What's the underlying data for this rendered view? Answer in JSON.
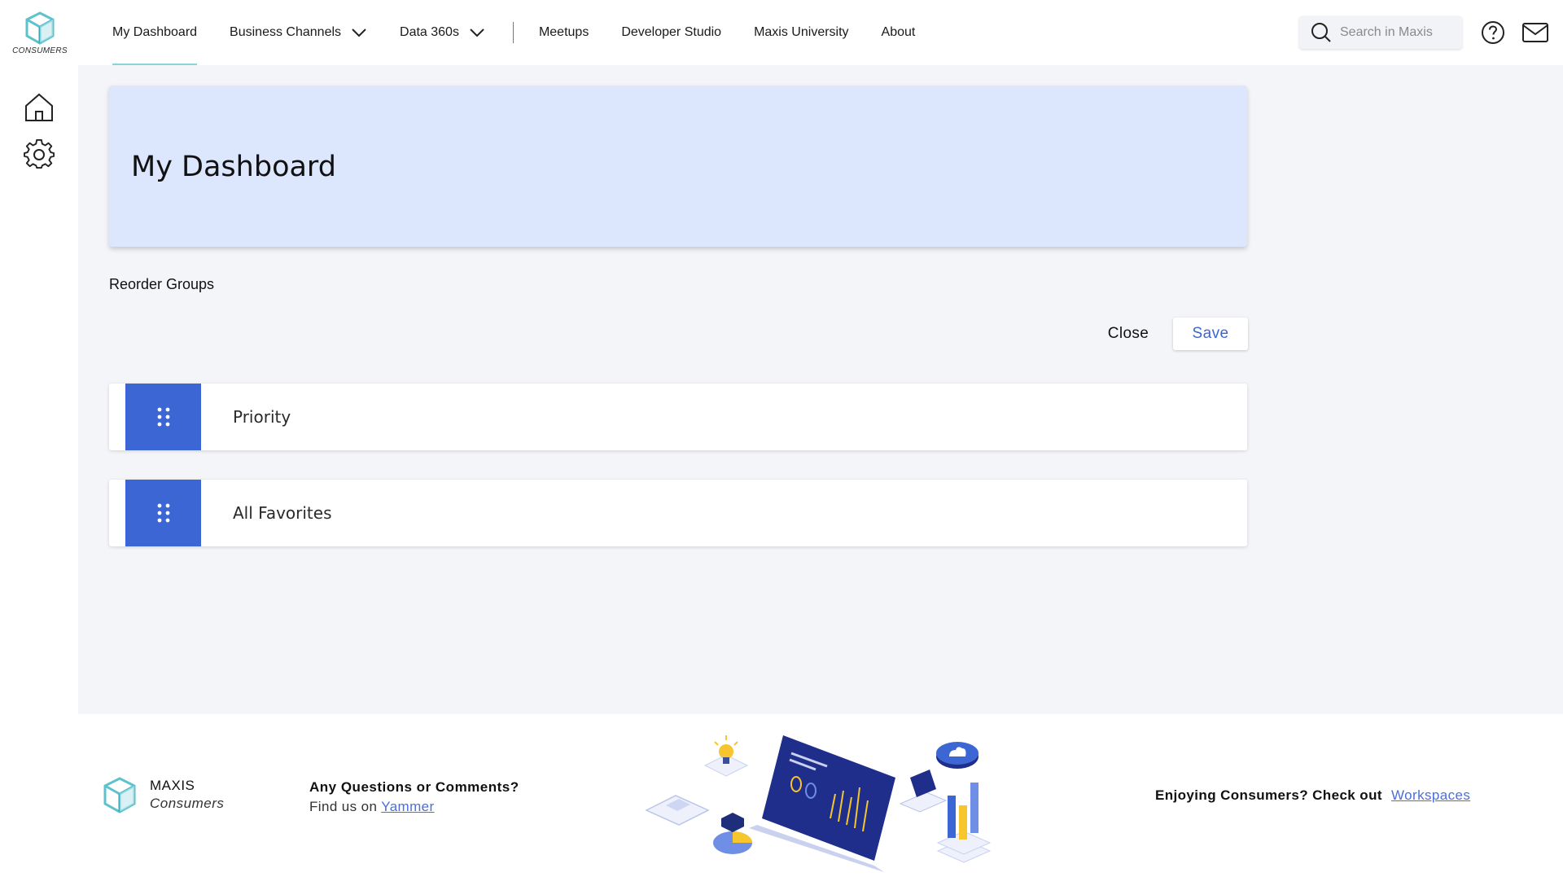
{
  "app": {
    "logo_text": "CONSUMERS"
  },
  "nav": {
    "items": [
      {
        "label": "My Dashboard",
        "active": true
      },
      {
        "label": "Business Channels",
        "dropdown": true
      },
      {
        "label": "Data 360s",
        "dropdown": true
      },
      {
        "label": "Meetups"
      },
      {
        "label": "Developer Studio"
      },
      {
        "label": "Maxis University"
      },
      {
        "label": "About"
      }
    ]
  },
  "search": {
    "placeholder": "Search in Maxis"
  },
  "icons": {
    "search": "search-icon",
    "help": "help-icon",
    "mail": "mail-icon",
    "home": "home-icon",
    "settings": "gear-icon",
    "drag": "drag-handle-icon"
  },
  "hero": {
    "title": "My Dashboard"
  },
  "reorder": {
    "title": "Reorder Groups",
    "close_label": "Close",
    "save_label": "Save",
    "groups": [
      {
        "label": "Priority"
      },
      {
        "label": "All Favorites"
      }
    ]
  },
  "footer": {
    "brand_line1": "MAXIS",
    "brand_line2": "Consumers",
    "questions": "Any Questions or Comments?",
    "find_us": "Find us on",
    "yammer": "Yammer",
    "enjoying": "Enjoying Consumers? Check out",
    "workspaces": "Workspaces"
  },
  "colors": {
    "accent": "#3c66d3",
    "hero_bg": "#dce6fd",
    "main_bg": "#f4f5f8",
    "logo_teal": "#5cc2cd",
    "link": "#4b6fd6"
  }
}
